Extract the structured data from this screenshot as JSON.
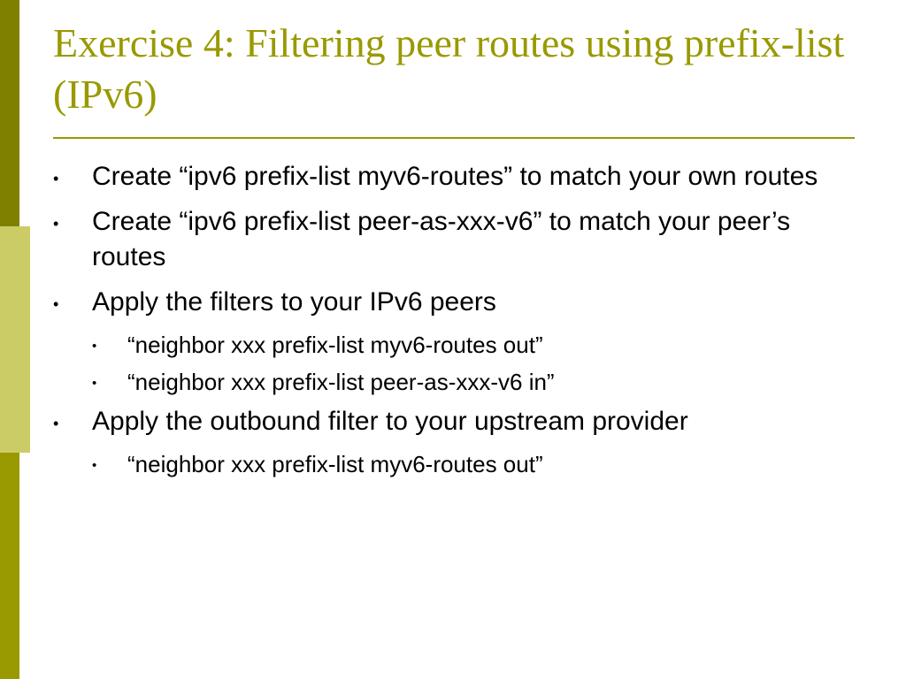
{
  "title": "Exercise 4: Filtering peer routes using prefix-list (IPv6)",
  "bullets": {
    "b1": "Create  “ipv6 prefix-list myv6-routes” to match your own routes",
    "b2": "Create “ipv6 prefix-list peer-as-xxx-v6” to match your peer’s routes",
    "b3": "Apply the filters to your IPv6 peers",
    "b3_1": "“neighbor xxx prefix-list myv6-routes out”",
    "b3_2": "“neighbor xxx prefix-list peer-as-xxx-v6 in”",
    "b4": "Apply the outbound filter to your upstream provider",
    "b4_1": "“neighbor xxx prefix-list myv6-routes out”"
  }
}
